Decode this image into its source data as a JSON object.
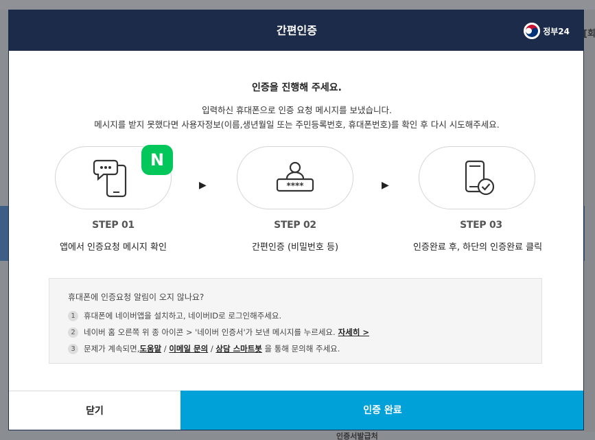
{
  "modal": {
    "title": "간편인증",
    "brand": "정부24"
  },
  "content": {
    "heading": "인증을 진행해 주세요.",
    "desc_line1": "입력하신 휴대폰으로 인증 요청 메시지를 보냈습니다.",
    "desc_line2": "메시지를 받지 못했다면 사용자정보(이름,생년월일 또는 주민등록번호, 휴대폰번호)를 확인 후 다시 시도해주세요."
  },
  "steps": [
    {
      "label": "STEP 01",
      "desc": "앱에서 인증요청 메시지 확인",
      "icon": "phone-message-icon"
    },
    {
      "label": "STEP 02",
      "desc": "간편인증 (비밀번호 등)",
      "icon": "user-password-icon"
    },
    {
      "label": "STEP 03",
      "desc": "인증완료 후, 하단의 인증완료 클릭",
      "icon": "phone-check-icon"
    }
  ],
  "step_arrow": "▶",
  "naver_badge": "N",
  "help": {
    "title": "휴대폰에 인증요청 알림이 오지 않나요?",
    "items": [
      {
        "num": "1",
        "text": "휴대폰에 네이버앱을 설치하고, 네이버ID로 로그인해주세요."
      },
      {
        "num": "2",
        "text": "네이버 홈 오른쪽 위 종 아이콘 > '네이버 인증서'가 보낸 메시지를 누르세요.",
        "link": "자세히 >"
      },
      {
        "num": "3",
        "text_before": "문제가 계속되면, ",
        "link1": "도움말",
        "sep1": " / ",
        "link2": "이메일 문의",
        "sep2": " / ",
        "link3": "상담 스마트봇",
        "text_after": " 을 통해 문의해 주세요."
      }
    ]
  },
  "footer": {
    "close": "닫기",
    "complete": "인증 완료"
  },
  "background": {
    "frag_right_top": "[회",
    "frag_bottom": "인증서발급처"
  }
}
